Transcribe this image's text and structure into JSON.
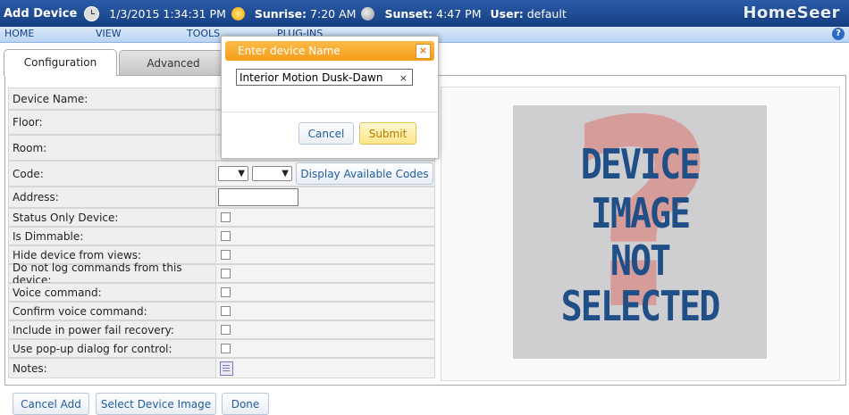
{
  "header": {
    "page_title": "Add Device",
    "datetime": "1/3/2015 1:34:31 PM",
    "sunrise_label": "Sunrise:",
    "sunrise_time": "7:20 AM",
    "sunset_label": "Sunset:",
    "sunset_time": "4:47 PM",
    "user_label": "User:",
    "user_name": "default",
    "logo_text": "HomeSeer"
  },
  "menu": {
    "items": [
      "HOME",
      "VIEW",
      "TOOLS",
      "PLUG-INS"
    ],
    "help_symbol": "?"
  },
  "tabs": [
    {
      "label": "Configuration",
      "active": true
    },
    {
      "label": "Advanced",
      "active": false
    }
  ],
  "form": {
    "labels": {
      "device_name": "Device Name:",
      "floor": "Floor:",
      "room": "Room:",
      "code": "Code:",
      "address": "Address:",
      "status_only": "Status Only Device:",
      "dimmable": "Is Dimmable:",
      "hide": "Hide device from views:",
      "no_log": "Do not log commands from this device:",
      "voice": "Voice command:",
      "confirm_voice": "Confirm voice command:",
      "power_fail": "Include in power fail recovery:",
      "popup": "Use pop-up dialog for control:",
      "notes": "Notes:"
    },
    "display_codes_button": "Display Available Codes",
    "dropdown_arrow": "▼"
  },
  "device_image": {
    "line1": "DEVICE",
    "line2": "IMAGE",
    "line3": "NOT",
    "line4": "SELECTED",
    "symbol": "?"
  },
  "footer": {
    "cancel_add": "Cancel Add",
    "select_image": "Select Device Image",
    "done": "Done"
  },
  "dialog": {
    "title": "Enter device Name",
    "close_symbol": "×",
    "input_value": "Interior Motion Dusk-Dawn",
    "clear_symbol": "×",
    "cancel": "Cancel",
    "submit": "Submit"
  },
  "colors": {
    "titlebar": "#1f4e98",
    "dialog_header": "#f7a625",
    "link_blue": "#1f5c9b"
  }
}
